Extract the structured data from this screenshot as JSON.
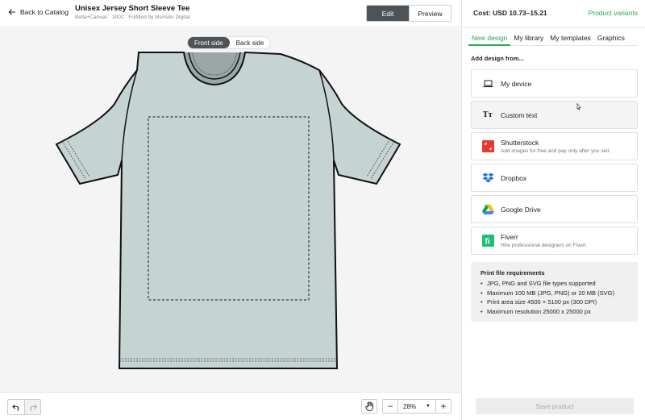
{
  "header": {
    "back_label": "Back to Catalog",
    "product_title": "Unisex Jersey Short Sleeve Tee",
    "product_subtitle": "Bella+Canvas · 3001 · Fulfilled by Monster Digital",
    "edit_label": "Edit",
    "preview_label": "Preview"
  },
  "canvas": {
    "front_label": "Front side",
    "back_label": "Back side",
    "shirt_color": "#c5d4d3"
  },
  "bottom": {
    "zoom_value": "28%"
  },
  "panel": {
    "cost": "Cost: USD 10.73–15.21",
    "variants_link": "Product variants",
    "tabs": [
      "New design",
      "My library",
      "My templates",
      "Graphics"
    ],
    "add_from": "Add design from...",
    "sources": [
      {
        "name": "My device",
        "desc": "",
        "icon": "laptop-icon"
      },
      {
        "name": "Custom text",
        "desc": "",
        "icon": "text-icon"
      },
      {
        "name": "Shutterstock",
        "desc": "Add images for free and pay only after you sell.",
        "icon": "shutterstock-icon"
      },
      {
        "name": "Dropbox",
        "desc": "",
        "icon": "dropbox-icon"
      },
      {
        "name": "Google Drive",
        "desc": "",
        "icon": "google-drive-icon"
      },
      {
        "name": "Fiverr",
        "desc": "Hire professional designers on Fiverr.",
        "icon": "fiverr-icon"
      }
    ],
    "requirements": {
      "title": "Print file requirements",
      "items": [
        "JPG, PNG and SVG file types supported",
        "Maximum 100 MB (JPG, PNG) or 20 MB (SVG)",
        "Print area size 4500 × 5100 px (300 DPI)",
        "Maximum resolution 25000 x 25000 px"
      ]
    },
    "save_label": "Save product"
  },
  "colors": {
    "accent": "#2aa556",
    "dark": "#4e5357"
  }
}
